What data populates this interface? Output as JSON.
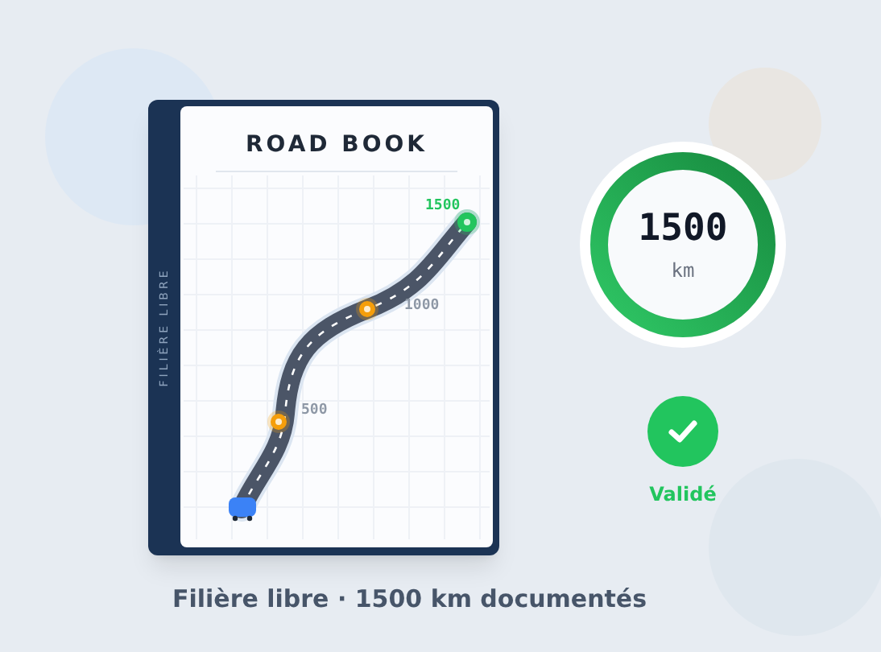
{
  "book": {
    "spine_label": "FILIÈRE LIBRE",
    "title": "ROAD BOOK",
    "milestones": [
      {
        "label": "500",
        "kind": "checkpoint"
      },
      {
        "label": "1000",
        "kind": "checkpoint"
      },
      {
        "label": "1500",
        "kind": "finish"
      }
    ]
  },
  "distance_gauge": {
    "value": "1500",
    "unit": "km",
    "level": 1
  },
  "status": {
    "validated": true,
    "label": "Validé"
  },
  "caption": "Filière libre · 1500 km documentés"
}
